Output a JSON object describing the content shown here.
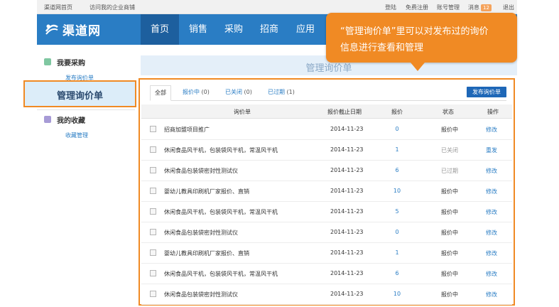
{
  "topbar": {
    "left_links": [
      "渠道网首页",
      "访问我的企业商铺"
    ],
    "right_links": [
      "登陆",
      "免费注册",
      "账号管理",
      "消息",
      "退出"
    ],
    "message_count": "12"
  },
  "header": {
    "logo_text": "渠道网",
    "nav": [
      "首页",
      "销售",
      "采购",
      "招商",
      "应用"
    ],
    "active_nav": "首页"
  },
  "sidebar": {
    "sections": [
      {
        "title": "我要采购",
        "links": [
          "发布询价单"
        ]
      },
      {
        "title": "我的收藏",
        "links": [
          "收藏管理"
        ]
      }
    ],
    "highlighted_item": "管理询价单"
  },
  "main": {
    "title": "管理询价单",
    "tabs": [
      {
        "label": "全部",
        "count": ""
      },
      {
        "label": "报价中",
        "count": "(0)"
      },
      {
        "label": "已关闭",
        "count": "(0)"
      },
      {
        "label": "已过期",
        "count": "(1)"
      }
    ],
    "publish_button": "发布询价单",
    "columns": [
      "询价单",
      "报价截止日期",
      "报价",
      "状态",
      "操作"
    ],
    "rows": [
      {
        "name": "招商加盟项目推广",
        "date": "2014-11-23",
        "quotes": "0",
        "status": "报价中",
        "action": "修改"
      },
      {
        "name": "休闲食品风干机，包装袋风干机，常温风干机",
        "date": "2014-11-23",
        "quotes": "1",
        "status": "已关闭",
        "action": "重发"
      },
      {
        "name": "休闲食品包装袋密封性测试仪",
        "date": "2014-11-23",
        "quotes": "6",
        "status": "已过期",
        "action": "修改"
      },
      {
        "name": "婴幼儿教具印刷机厂家报价、直销",
        "date": "2014-11-23",
        "quotes": "10",
        "status": "报价中",
        "action": "修改"
      },
      {
        "name": "休闲食品风干机，包装袋风干机，常温风干机",
        "date": "2014-11-23",
        "quotes": "5",
        "status": "报价中",
        "action": "修改"
      },
      {
        "name": "休闲食品包装袋密封性测试仪",
        "date": "2014-11-23",
        "quotes": "0",
        "status": "报价中",
        "action": "修改"
      },
      {
        "name": "婴幼儿教具印刷机厂家报价、直销",
        "date": "2014-11-23",
        "quotes": "1",
        "status": "报价中",
        "action": "修改"
      },
      {
        "name": "休闲食品风干机，包装袋风干机，常温风干机",
        "date": "2014-11-23",
        "quotes": "6",
        "status": "报价中",
        "action": "修改"
      },
      {
        "name": "休闲食品包装袋密封性测试仪",
        "date": "2014-11-23",
        "quotes": "10",
        "status": "报价中",
        "action": "修改"
      }
    ]
  },
  "callout": {
    "line1": "“管理询价单”里可以对发布过的询价",
    "line2": "信息进行查看和管理"
  },
  "colors": {
    "brand_blue": "#2a7dc4",
    "accent_orange": "#f08a24"
  }
}
